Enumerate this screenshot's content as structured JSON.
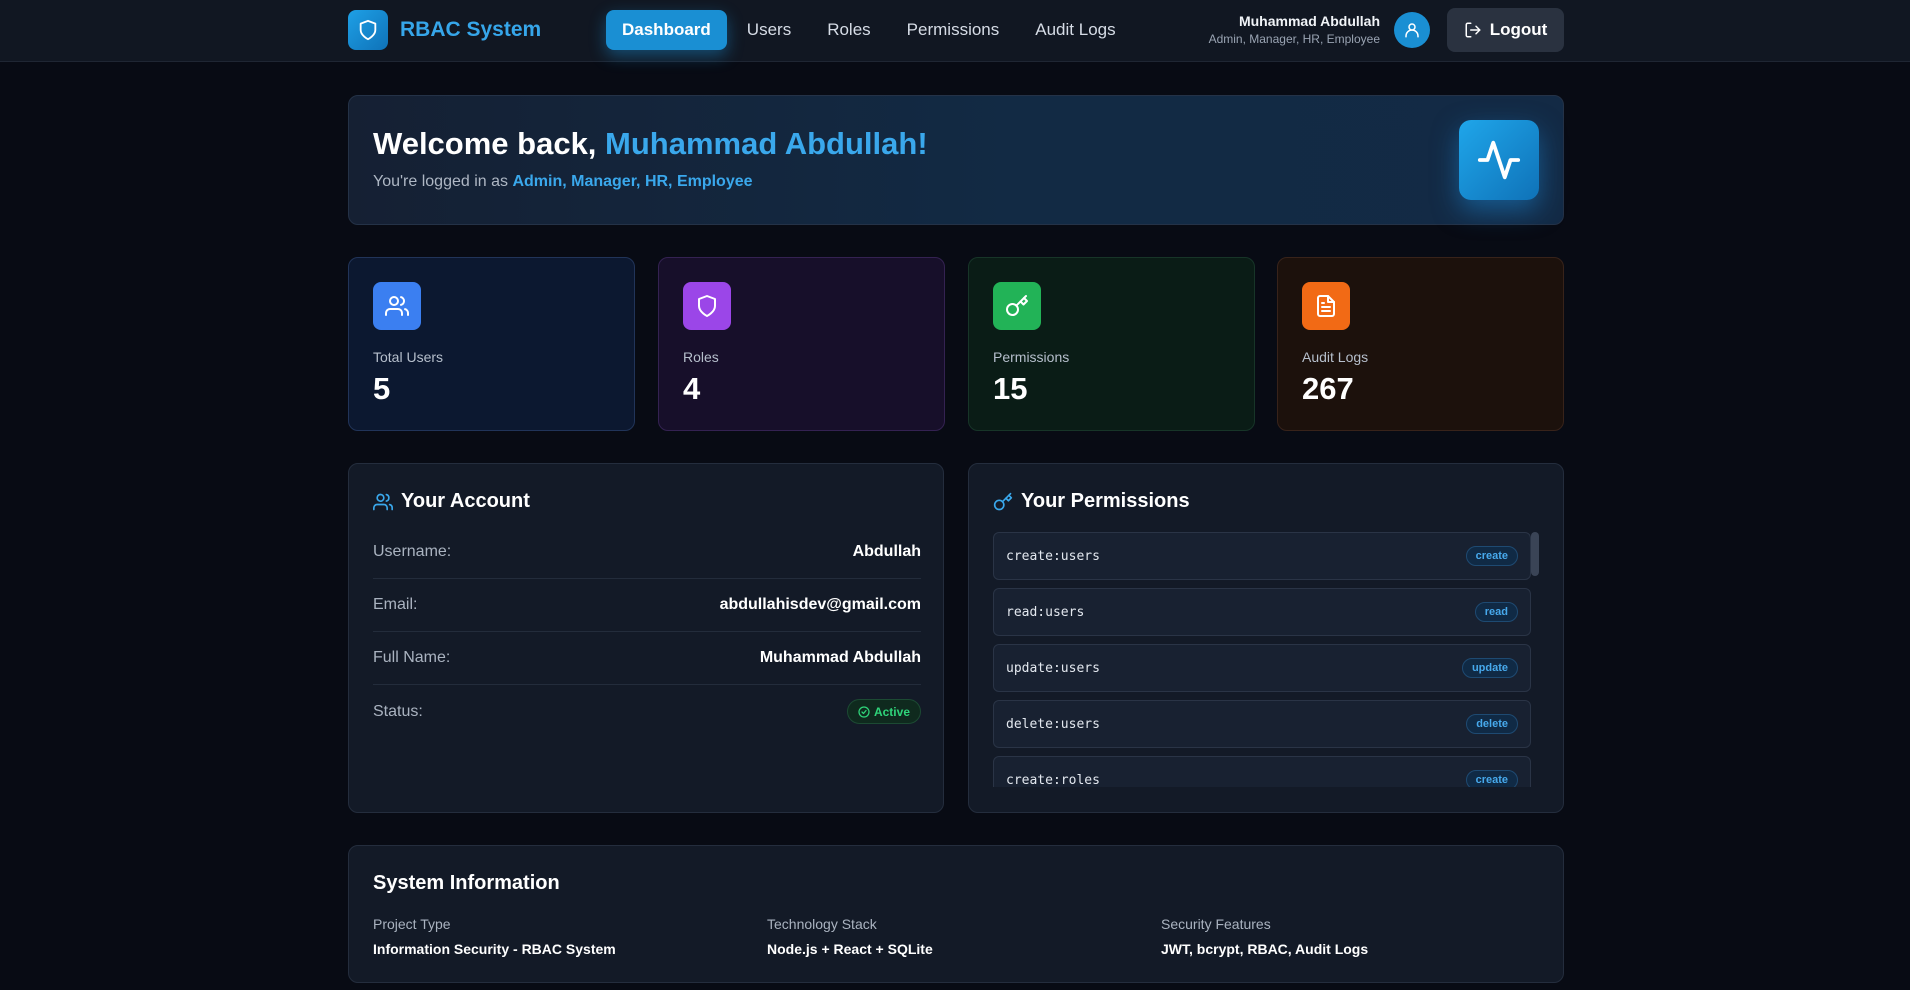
{
  "header": {
    "brand": "RBAC System",
    "nav": [
      "Dashboard",
      "Users",
      "Roles",
      "Permissions",
      "Audit Logs"
    ],
    "active_nav": "Dashboard",
    "user_name": "Muhammad Abdullah",
    "user_roles": "Admin, Manager, HR, Employee",
    "logout_label": "Logout"
  },
  "welcome": {
    "greeting": "Welcome back, ",
    "name": "Muhammad Abdullah!",
    "logged_in_prefix": "You're logged in as ",
    "roles": "Admin, Manager, HR, Employee"
  },
  "stats": [
    {
      "label": "Total Users",
      "value": "5",
      "icon": "users-icon",
      "color": "#3b7ff1"
    },
    {
      "label": "Roles",
      "value": "4",
      "icon": "shield-icon",
      "color": "#9b46e8"
    },
    {
      "label": "Permissions",
      "value": "15",
      "icon": "key-icon",
      "color": "#22b357"
    },
    {
      "label": "Audit Logs",
      "value": "267",
      "icon": "document-icon",
      "color": "#f26a15"
    }
  ],
  "account": {
    "title": "Your Account",
    "rows": [
      {
        "label": "Username:",
        "value": "Abdullah"
      },
      {
        "label": "Email:",
        "value": "abdullahisdev@gmail.com"
      },
      {
        "label": "Full Name:",
        "value": "Muhammad Abdullah"
      }
    ],
    "status_label": "Status:",
    "status_value": "Active"
  },
  "permissions": {
    "title": "Your Permissions",
    "items": [
      {
        "code": "create:users",
        "tag": "create"
      },
      {
        "code": "read:users",
        "tag": "read"
      },
      {
        "code": "update:users",
        "tag": "update"
      },
      {
        "code": "delete:users",
        "tag": "delete"
      },
      {
        "code": "create:roles",
        "tag": "create"
      }
    ]
  },
  "system": {
    "title": "System Information",
    "items": [
      {
        "label": "Project Type",
        "value": "Information Security - RBAC System"
      },
      {
        "label": "Technology Stack",
        "value": "Node.js + React + SQLite"
      },
      {
        "label": "Security Features",
        "value": "JWT, bcrypt, RBAC, Audit Logs"
      }
    ]
  },
  "colors": {
    "accent": "#1a8fd3",
    "active": "#2fd47a",
    "background": "#080b14"
  }
}
